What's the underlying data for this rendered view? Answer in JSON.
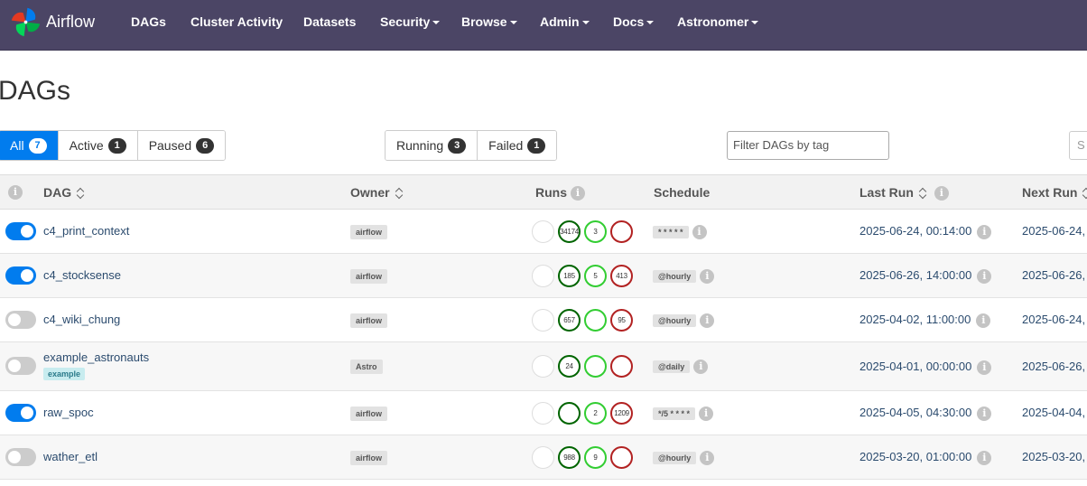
{
  "nav": {
    "brand": "Airflow",
    "items": [
      {
        "label": "DAGs",
        "caret": false
      },
      {
        "label": "Cluster Activity",
        "caret": false
      },
      {
        "label": "Datasets",
        "caret": false
      },
      {
        "label": "Security",
        "caret": true
      },
      {
        "label": "Browse",
        "caret": true
      },
      {
        "label": "Admin",
        "caret": true
      },
      {
        "label": "Docs",
        "caret": true
      },
      {
        "label": "Astronomer",
        "caret": true
      }
    ]
  },
  "page": {
    "title": "DAGs"
  },
  "filters": {
    "status": [
      {
        "label": "All",
        "count": "7",
        "active": true
      },
      {
        "label": "Active",
        "count": "1",
        "active": false
      },
      {
        "label": "Paused",
        "count": "6",
        "active": false
      }
    ],
    "state": [
      {
        "label": "Running",
        "count": "3"
      },
      {
        "label": "Failed",
        "count": "1"
      }
    ],
    "tag_placeholder": "Filter DAGs by tag",
    "search_placeholder": "S"
  },
  "table": {
    "headers": {
      "dag": "DAG",
      "owner": "Owner",
      "runs": "Runs",
      "schedule": "Schedule",
      "last_run": "Last Run",
      "next_run": "Next Run"
    },
    "info_glyph": "i",
    "rows": [
      {
        "enabled": true,
        "dag_id": "c4_print_context",
        "tag": "",
        "owner": "airflow",
        "runs": [
          {
            "state": "queued",
            "count": ""
          },
          {
            "state": "success",
            "count": "34174"
          },
          {
            "state": "running",
            "count": "3"
          },
          {
            "state": "failed",
            "count": ""
          }
        ],
        "schedule": "* * * * *",
        "last_run": "2025-06-24, 00:14:00",
        "next_run": "2025-06-24,"
      },
      {
        "enabled": true,
        "dag_id": "c4_stocksense",
        "tag": "",
        "owner": "airflow",
        "runs": [
          {
            "state": "queued",
            "count": ""
          },
          {
            "state": "success",
            "count": "185"
          },
          {
            "state": "running",
            "count": "5"
          },
          {
            "state": "failed",
            "count": "413"
          }
        ],
        "schedule": "@hourly",
        "last_run": "2025-06-26, 14:00:00",
        "next_run": "2025-06-26,"
      },
      {
        "enabled": false,
        "dag_id": "c4_wiki_chung",
        "tag": "",
        "owner": "airflow",
        "runs": [
          {
            "state": "queued",
            "count": ""
          },
          {
            "state": "success",
            "count": "657"
          },
          {
            "state": "running",
            "count": ""
          },
          {
            "state": "failed",
            "count": "95"
          }
        ],
        "schedule": "@hourly",
        "last_run": "2025-04-02, 11:00:00",
        "next_run": "2025-06-24,"
      },
      {
        "enabled": false,
        "dag_id": "example_astronauts",
        "tag": "example",
        "owner": "Astro",
        "runs": [
          {
            "state": "queued",
            "count": ""
          },
          {
            "state": "success",
            "count": "24"
          },
          {
            "state": "running",
            "count": ""
          },
          {
            "state": "failed",
            "count": ""
          }
        ],
        "schedule": "@daily",
        "last_run": "2025-04-01, 00:00:00",
        "next_run": "2025-06-26,"
      },
      {
        "enabled": true,
        "dag_id": "raw_spoc",
        "tag": "",
        "owner": "airflow",
        "runs": [
          {
            "state": "queued",
            "count": ""
          },
          {
            "state": "success",
            "count": ""
          },
          {
            "state": "running",
            "count": "2"
          },
          {
            "state": "failed",
            "count": "1209"
          }
        ],
        "schedule": "*/5 * * * *",
        "last_run": "2025-04-05, 04:30:00",
        "next_run": "2025-04-04,"
      },
      {
        "enabled": false,
        "dag_id": "wather_etl",
        "tag": "",
        "owner": "airflow",
        "runs": [
          {
            "state": "queued",
            "count": ""
          },
          {
            "state": "success",
            "count": "988"
          },
          {
            "state": "running",
            "count": "9"
          },
          {
            "state": "failed",
            "count": ""
          }
        ],
        "schedule": "@hourly",
        "last_run": "2025-03-20, 01:00:00",
        "next_run": "2025-03-20,"
      }
    ]
  },
  "colors": {
    "navbar": "#4b4565",
    "primary": "#017cee",
    "success": "#006400",
    "running": "#32cd32",
    "failed": "#b22222",
    "link": "#2b4b6e"
  }
}
